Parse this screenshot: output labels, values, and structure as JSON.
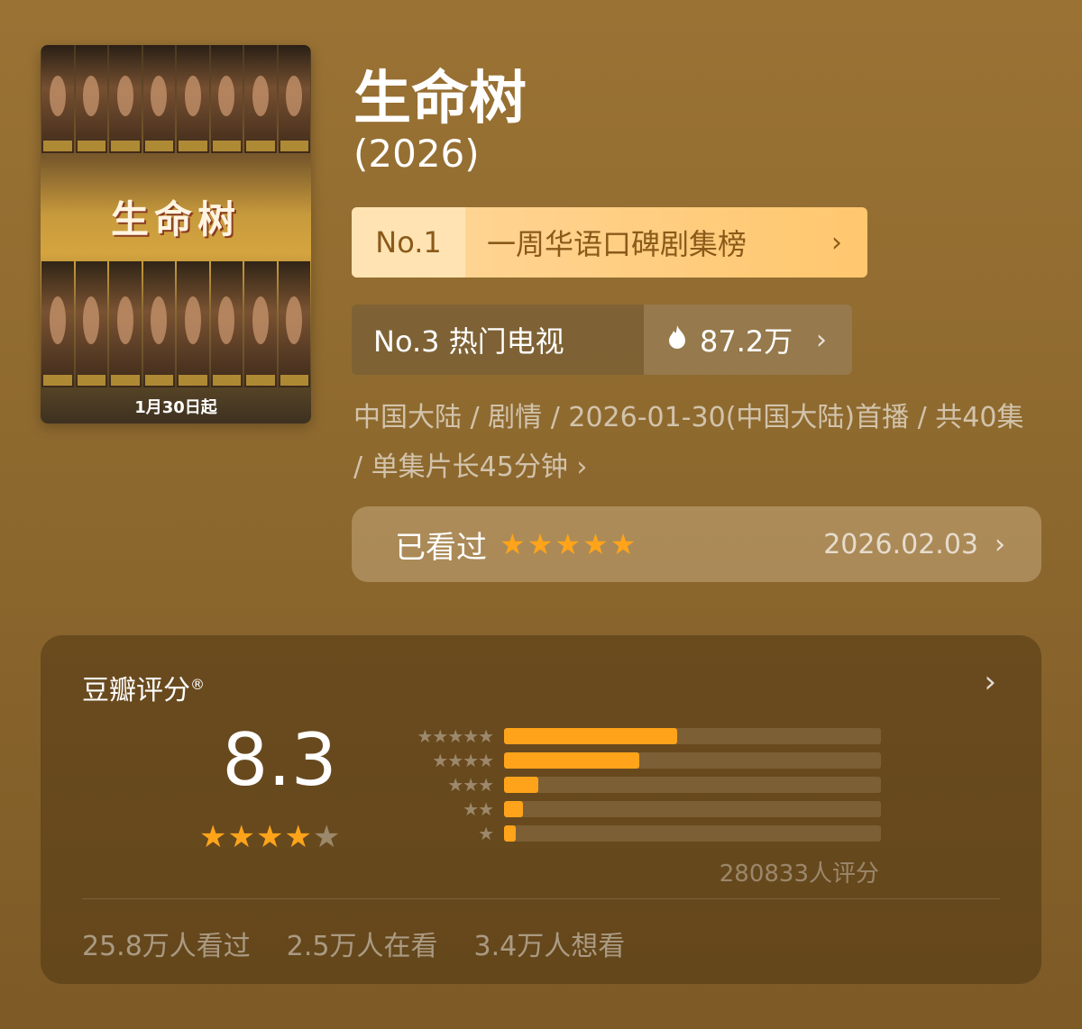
{
  "poster": {
    "title_art": "生命树",
    "date_text": "1月30日起"
  },
  "header": {
    "title": "生命树",
    "year": "(2026)"
  },
  "rank_primary": {
    "number": "No.1",
    "label": "一周华语口碑剧集榜"
  },
  "rank_secondary": {
    "label": "No.3 热门电视",
    "heat": "87.2万"
  },
  "meta": {
    "text": "中国大陆 / 剧情 / 2026-01-30(中国大陆)首播 / 共40集 / 单集片长45分钟",
    "chevron": "›"
  },
  "watched": {
    "label": "已看过",
    "stars": "★★★★★",
    "date": "2026.02.03"
  },
  "rating": {
    "title": "豆瓣评分",
    "registered_mark": "®",
    "score": "8.3",
    "stars_filled": 4,
    "count_text": "280833人评分",
    "distribution": [
      {
        "stars": "★★★★★",
        "fraction": 0.46
      },
      {
        "stars": "★★★★",
        "fraction": 0.36
      },
      {
        "stars": "★★★",
        "fraction": 0.09
      },
      {
        "stars": "★★",
        "fraction": 0.05
      },
      {
        "stars": "★",
        "fraction": 0.03
      }
    ],
    "stats": [
      "25.8万人看过",
      "2.5万人在看",
      "3.4万人想看"
    ]
  },
  "colors": {
    "accent": "#ffa41a",
    "rank_badge": "#ffc76e",
    "background": "#8f6a2f"
  }
}
